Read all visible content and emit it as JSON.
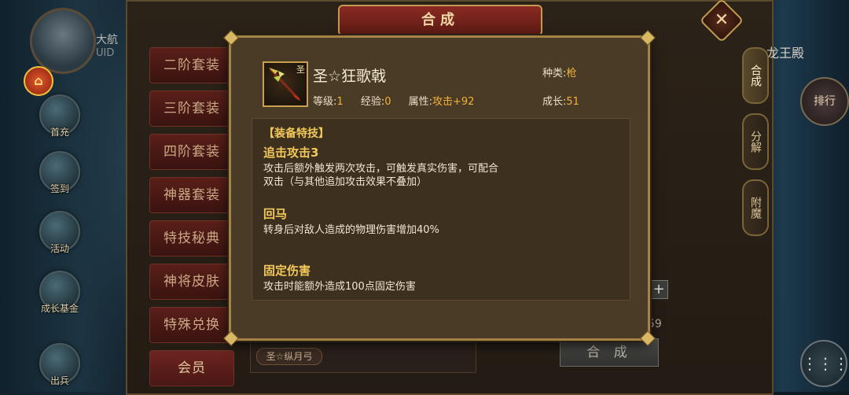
{
  "background": {
    "avatar_name": "大航",
    "avatar_uid": "UID",
    "side_icons": [
      "首充",
      "签到",
      "活动",
      "成长基金",
      "出兵"
    ],
    "window_title": "合成",
    "right_title": "龙王殿",
    "rank_label": "排行",
    "left_menu": [
      "二阶套装",
      "三阶套装",
      "四阶套装",
      "神器套装",
      "特技秘典",
      "神将皮肤",
      "特殊兑换",
      "会员"
    ],
    "right_tabs": [
      "合成",
      "分解",
      "附魔"
    ],
    "combine_button": "合 成",
    "count": "59",
    "item_tag": "圣☆纵月弓",
    "plus": "+",
    "close": "✕",
    "menu_icon": "⋮⋮⋮"
  },
  "popup": {
    "item": {
      "icon": "spear-icon",
      "icon_tag": "圣",
      "name": "圣☆狂歌戟",
      "kind_label": "种类:",
      "kind_value": "枪",
      "level_label": "等级:",
      "level_value": "1",
      "exp_label": "经验:",
      "exp_value": "0",
      "attr_label": "属性:",
      "attr_value": "攻击+92",
      "growth_label": "成长:",
      "growth_value": "51"
    },
    "skills_header": "【装备特技】",
    "skills": [
      {
        "name": "追击攻击3",
        "desc": "攻击后额外触发两次攻击，可触发真实伤害，可配合\n双击（与其他追加攻击效果不叠加）"
      },
      {
        "name": "回马",
        "desc": "转身后对敌人造成的物理伤害增加40%"
      },
      {
        "name": "固定伤害",
        "desc": "攻击时能额外造成100点固定伤害"
      }
    ]
  },
  "colors": {
    "gold": "#f3c85a",
    "orange_value": "#f2b13b",
    "popup_bg": "#4a3b26",
    "frame": "#a58246"
  }
}
